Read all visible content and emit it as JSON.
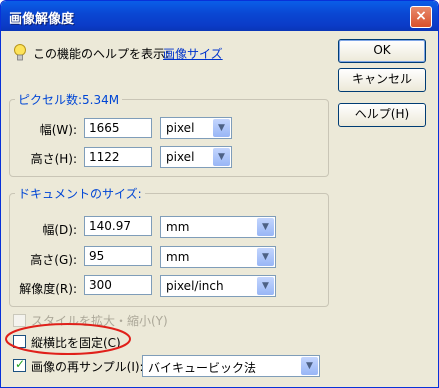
{
  "window": {
    "title": "画像解像度",
    "close_glyph": "×"
  },
  "help": {
    "text": "この機能のヘルプを表示:",
    "link": "画像サイズ"
  },
  "buttons": {
    "ok": "OK",
    "cancel": "キャンセル",
    "help": "ヘルプ(H)"
  },
  "pixel_section": {
    "legend": "ピクセル数:5.34M",
    "width": {
      "label": "幅(W):",
      "value": "1665",
      "unit": "pixel"
    },
    "height": {
      "label": "高さ(H):",
      "value": "1122",
      "unit": "pixel"
    }
  },
  "document_section": {
    "legend": "ドキュメントのサイズ:",
    "width": {
      "label": "幅(D):",
      "value": "140.97",
      "unit": "mm"
    },
    "height": {
      "label": "高さ(G):",
      "value": "95",
      "unit": "mm"
    },
    "resolution": {
      "label": "解像度(R):",
      "value": "300",
      "unit": "pixel/inch"
    }
  },
  "options": {
    "scale_styles": {
      "label": "スタイルを拡大・縮小(Y)",
      "checked": false,
      "enabled": false
    },
    "constrain": {
      "label": "縦横比を固定(C)",
      "checked": false
    },
    "resample": {
      "label": "画像の再サンプル(I):",
      "checked": true,
      "method": "バイキュービック法"
    }
  },
  "colors": {
    "title_bar": "#0a48d4",
    "dialog_bg": "#ece9d8",
    "link": "#0033cc",
    "highlight_ellipse": "#e0201a",
    "legend_text": "#0046d5"
  },
  "icons": {
    "help": "lightbulb-icon",
    "close": "close-icon",
    "dropdown": "chevron-down-icon"
  }
}
